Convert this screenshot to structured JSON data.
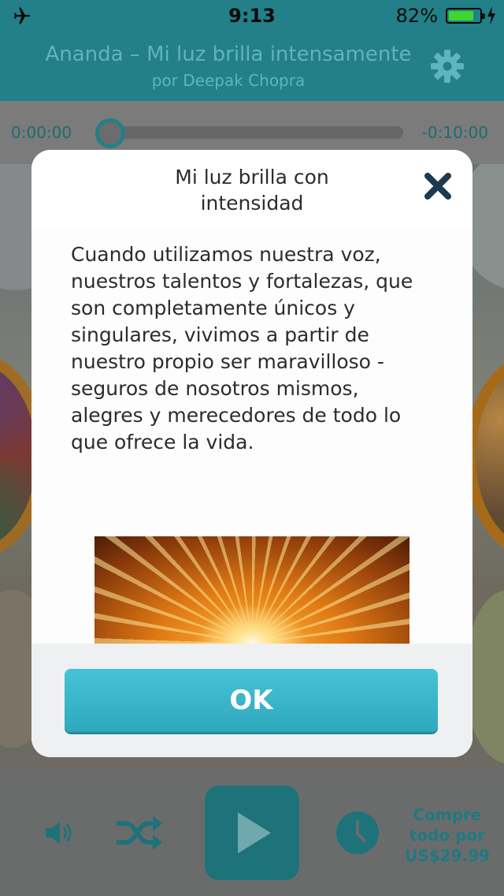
{
  "status_bar": {
    "time": "9:13",
    "battery_percent": "82%",
    "battery_level": 0.82,
    "icons": [
      "airplane-icon",
      "battery-icon",
      "charging-bolt-icon"
    ]
  },
  "header": {
    "title": "Ananda – Mi luz brilla intensamente",
    "subtitle": "por Deepak Chopra",
    "settings_icon": "gear-icon"
  },
  "player": {
    "elapsed": "0:00:00",
    "remaining": "-0:10:00",
    "progress": 0.0
  },
  "modal": {
    "title": "Mi luz brilla con intensidad",
    "body": "Cuando utilizamos nuestra voz, nuestros talentos y fortalezas, que son completamente únicos y singulares, vivimos a partir de nuestro propio ser maravilloso - seguros de nosotros mismos, alegres y merecedores de todo lo que ofrece la vida.",
    "ok_label": "OK",
    "close_icon": "close-icon"
  },
  "controls": {
    "icons": [
      "volume-icon",
      "shuffle-icon",
      "play-icon",
      "clock-icon"
    ],
    "buy_label": "Compre todo por US$29.99"
  },
  "colors": {
    "teal_dark": "#237f88",
    "teal_button": "#2fa8bc",
    "battery_green": "#3fd62e"
  }
}
